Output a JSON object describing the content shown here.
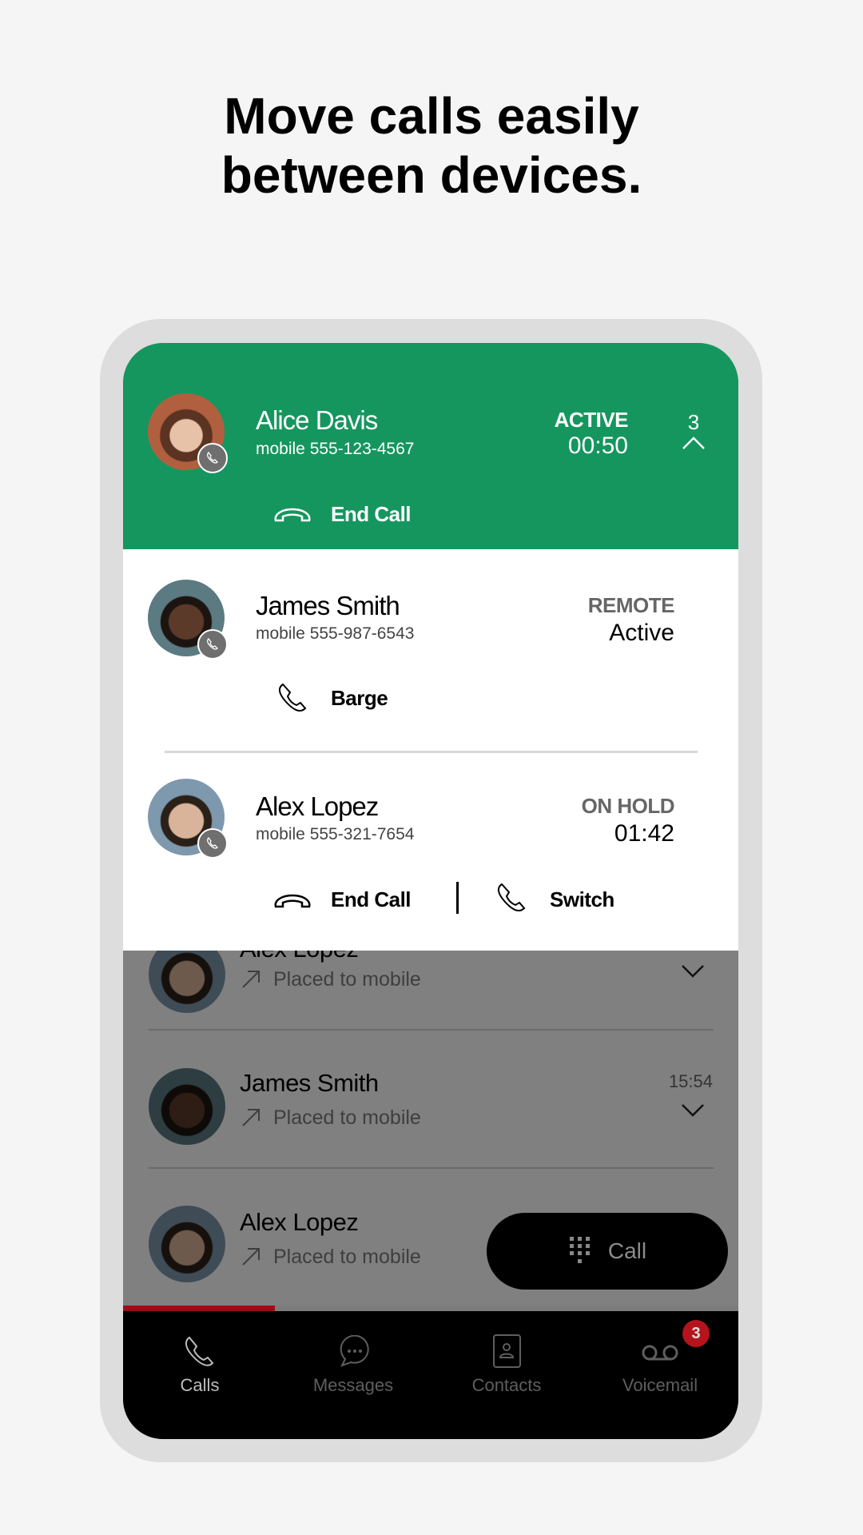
{
  "headline": {
    "line1": "Move calls easily",
    "line2": "between devices."
  },
  "colors": {
    "active_header": "#16965f",
    "accent_red": "#c8102e",
    "badge": "#b5141c"
  },
  "active_call": {
    "name": "Alice Davis",
    "number": "mobile 555-123-4567",
    "status": "ACTIVE",
    "timer": "00:50",
    "call_count": "3",
    "end_label": "End Call"
  },
  "other_calls": [
    {
      "name": "James Smith",
      "number": "mobile 555-987-6543",
      "status": "REMOTE",
      "detail": "Active",
      "action": "Barge"
    },
    {
      "name": "Alex Lopez",
      "number": "mobile 555-321-7654",
      "status": "ON HOLD",
      "detail": "01:42",
      "end_label": "End Call",
      "switch_label": "Switch"
    }
  ],
  "recent": [
    {
      "name": "Alex Lopez",
      "detail": "Placed to mobile",
      "time": ""
    },
    {
      "name": "James Smith",
      "detail": "Placed to mobile",
      "time": "15:54"
    },
    {
      "name": "Alex Lopez",
      "detail": "Placed to mobile",
      "time": ""
    }
  ],
  "call_button": "Call",
  "nav": [
    {
      "label": "Calls",
      "icon": "phone-icon",
      "active": true
    },
    {
      "label": "Messages",
      "icon": "chat-icon"
    },
    {
      "label": "Contacts",
      "icon": "contact-card-icon"
    },
    {
      "label": "Voicemail",
      "icon": "voicemail-icon",
      "badge": "3"
    }
  ]
}
